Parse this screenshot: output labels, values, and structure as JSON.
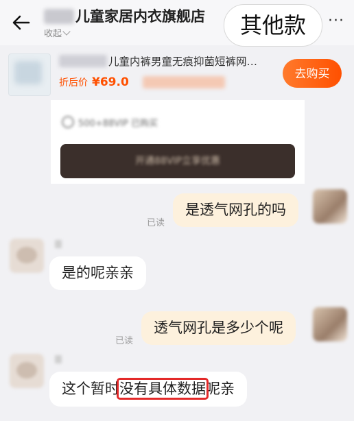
{
  "header": {
    "shop_name_visible": "儿童家居内衣旗舰店",
    "collapse_label": "收起",
    "other_styles_label": "其他款",
    "more_label": "···"
  },
  "product": {
    "title_visible": "儿童内裤男童无痕抑菌短裤网…",
    "price_label": "折后价",
    "price": "¥69.0",
    "buy_label": "去购买"
  },
  "promo_card": {
    "bought_text": "500+88VIP 已购买",
    "button_label": "开通88VIP立享优惠"
  },
  "messages": [
    {
      "side": "me",
      "text": "是透气网孔的吗",
      "status": "已读"
    },
    {
      "side": "shop",
      "text": "是的呢亲亲"
    },
    {
      "side": "me",
      "text": "透气网孔是多少个呢",
      "status": "已读"
    },
    {
      "side": "shop",
      "text_before": "这个暂时",
      "text_highlight": "没有具体数据",
      "text_after": "呢亲"
    }
  ],
  "colors": {
    "accent_orange": "#ff5000",
    "my_bubble": "#fdf1dd",
    "highlight_box": "#e32929"
  }
}
